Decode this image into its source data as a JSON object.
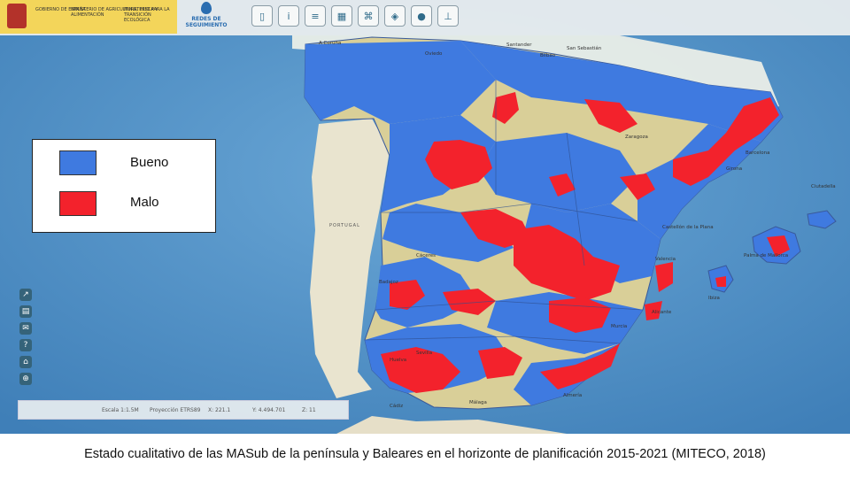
{
  "map": {
    "title_caption": "Estado cualitativo de las MASub de la península y Baleares en el horizonte de planificación 2015-2021 (MITECO, 2018)",
    "colors": {
      "sea": "#4f8fc4",
      "land_other": "#e8dcbc",
      "basin_tan": "#d9cf98",
      "bueno": "#3f7ae0",
      "malo": "#f3222c"
    },
    "country_label": "PORTUGAL",
    "places": [
      "A Coruña",
      "Santander",
      "San Sebastián",
      "Bilbao",
      "Oviedo",
      "Zaragoza",
      "Barcelona",
      "Castellón de la Plana",
      "Valencia",
      "Alicante",
      "Murcia",
      "Almería",
      "Málaga",
      "Sevilla",
      "Huelva",
      "Cádiz",
      "Badajoz",
      "Cáceres",
      "Palma de Mallorca",
      "Ciutadella",
      "Ibiza",
      "Girona"
    ]
  },
  "header": {
    "gov_lines": [
      "GOBIERNO DE ESPAÑA",
      "MINISTERIO DE AGRICULTURA, PESCA Y ALIMENTACIÓN",
      "MINISTERIO PARA LA TRANSICIÓN ECOLÓGICA"
    ],
    "app_name": "REDES DE SEGUIMIENTO",
    "toolbar_icons": [
      "thermometer-icon",
      "info-icon",
      "layers-icon",
      "map-icon",
      "network-icon",
      "stack-icon",
      "drop-icon",
      "tap-icon"
    ]
  },
  "sidebar": {
    "icons": [
      "export-icon",
      "print-icon",
      "mail-icon",
      "help-icon",
      "home-icon",
      "zoom-icon"
    ]
  },
  "legend": {
    "items": [
      {
        "label": "Bueno",
        "color": "#3f7ae0"
      },
      {
        "label": "Malo",
        "color": "#f3222c"
      }
    ]
  },
  "statusbar": {
    "fields": [
      "Escala 1:1.5M",
      "Proyección ETRS89",
      "X: 221.1",
      "Y: 4.494.701",
      "Z: 11"
    ]
  }
}
